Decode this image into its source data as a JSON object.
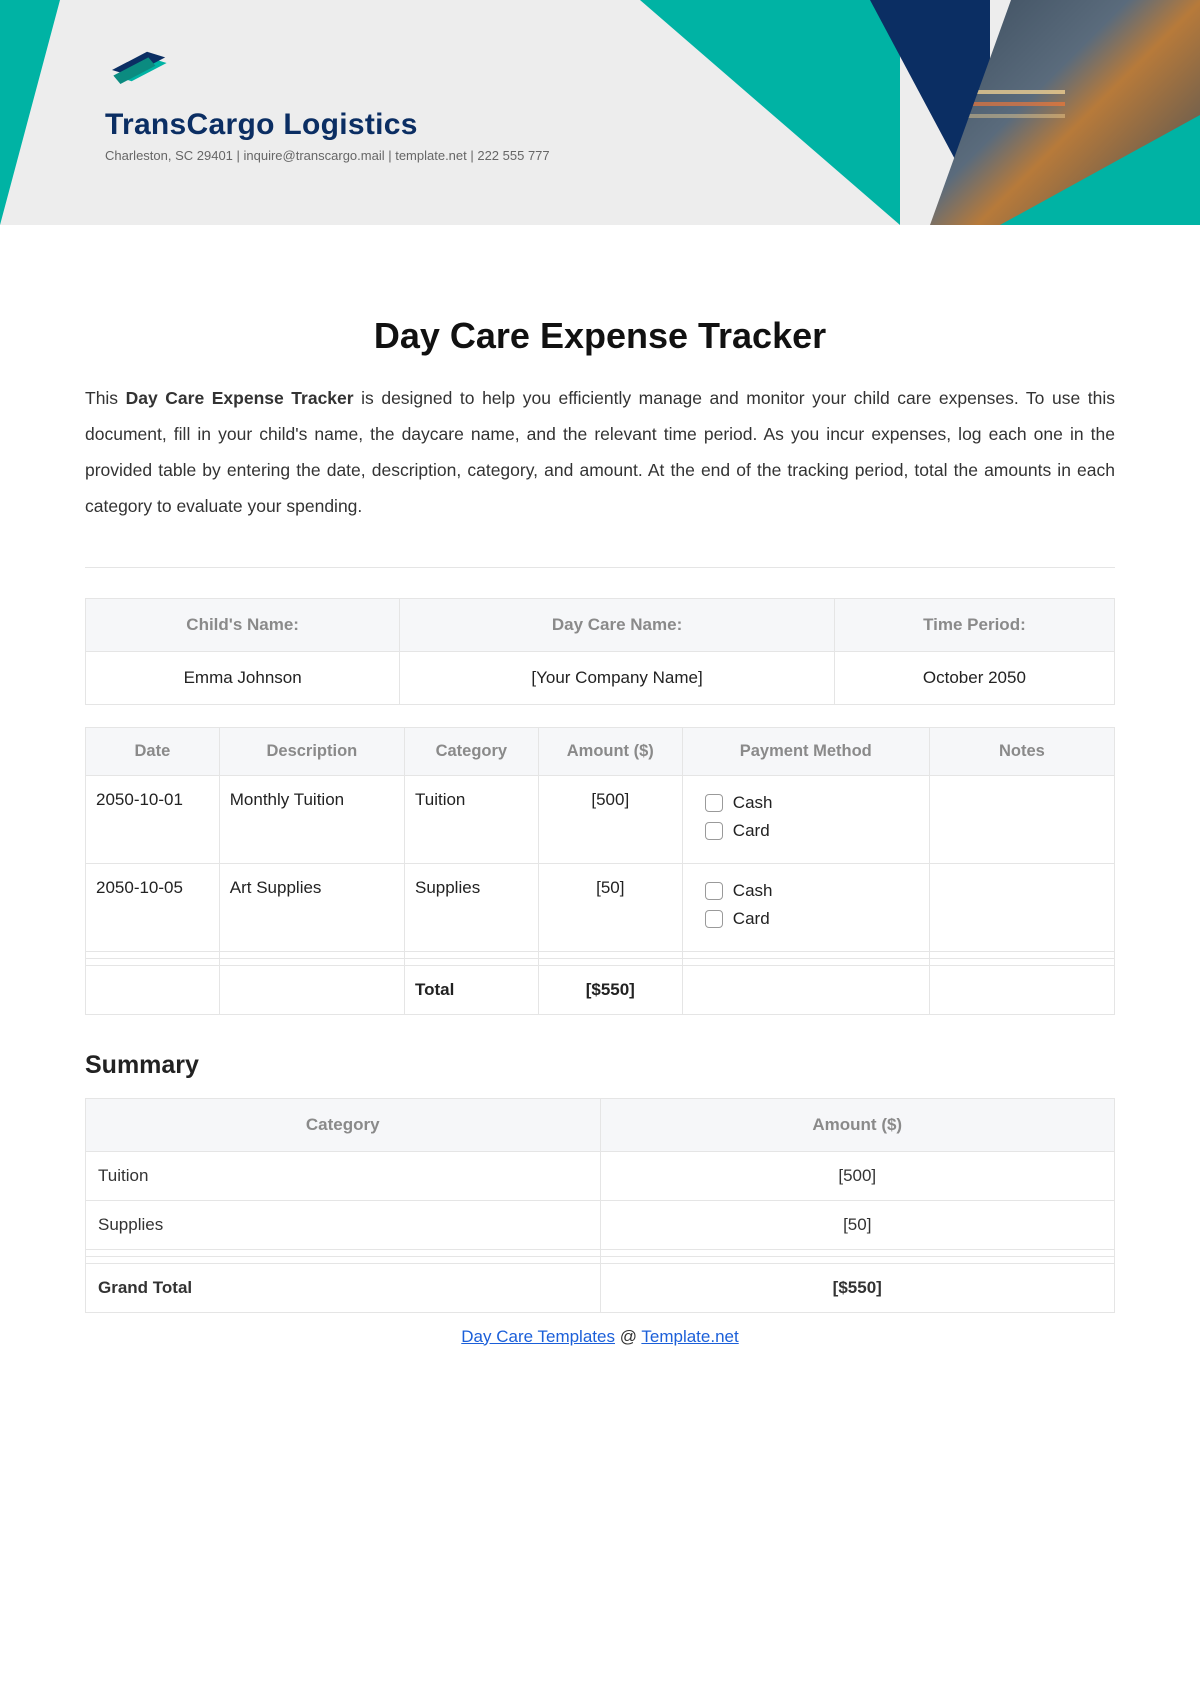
{
  "brand": {
    "name": "TransCargo Logistics",
    "tagline": "Charleston, SC 29401 | inquire@transcargo.mail | template.net | 222 555 777"
  },
  "title": "Day Care Expense Tracker",
  "intro": {
    "prefix": "This ",
    "bold": "Day Care Expense Tracker",
    "rest": " is designed to help you efficiently manage and monitor your child care expenses. To use this document, fill in your child's name, the daycare name, and the relevant time period. As you incur expenses, log each one in the provided table by entering the date, description, category, and amount. At the end of the tracking period, total the amounts in each category to evaluate your spending."
  },
  "info": {
    "headers": {
      "child": "Child's Name:",
      "daycare": "Day Care Name:",
      "period": "Time Period:"
    },
    "values": {
      "child": "Emma Johnson",
      "daycare": "[Your Company Name]",
      "period": "October 2050"
    }
  },
  "log": {
    "headers": {
      "date": "Date",
      "desc": "Description",
      "cat": "Category",
      "amt": "Amount ($)",
      "pay": "Payment Method",
      "notes": "Notes"
    },
    "payOptions": {
      "cash": "Cash",
      "card": "Card"
    },
    "rows": [
      {
        "date": "2050-10-01",
        "desc": "Monthly Tuition",
        "cat": "Tuition",
        "amt": "[500]",
        "notes": ""
      },
      {
        "date": "2050-10-05",
        "desc": "Art Supplies",
        "cat": "Supplies",
        "amt": "[50]",
        "notes": ""
      }
    ],
    "totalLabel": "Total",
    "totalValue": "[$550]"
  },
  "summary": {
    "heading": "Summary",
    "headers": {
      "cat": "Category",
      "amt": "Amount ($)"
    },
    "rows": [
      {
        "cat": "Tuition",
        "amt": "[500]"
      },
      {
        "cat": "Supplies",
        "amt": "[50]"
      }
    ],
    "grandLabel": "Grand Total",
    "grandValue": "[$550]"
  },
  "footer": {
    "left": "Day Care Templates",
    "sep": " @ ",
    "right": "Template.net"
  }
}
